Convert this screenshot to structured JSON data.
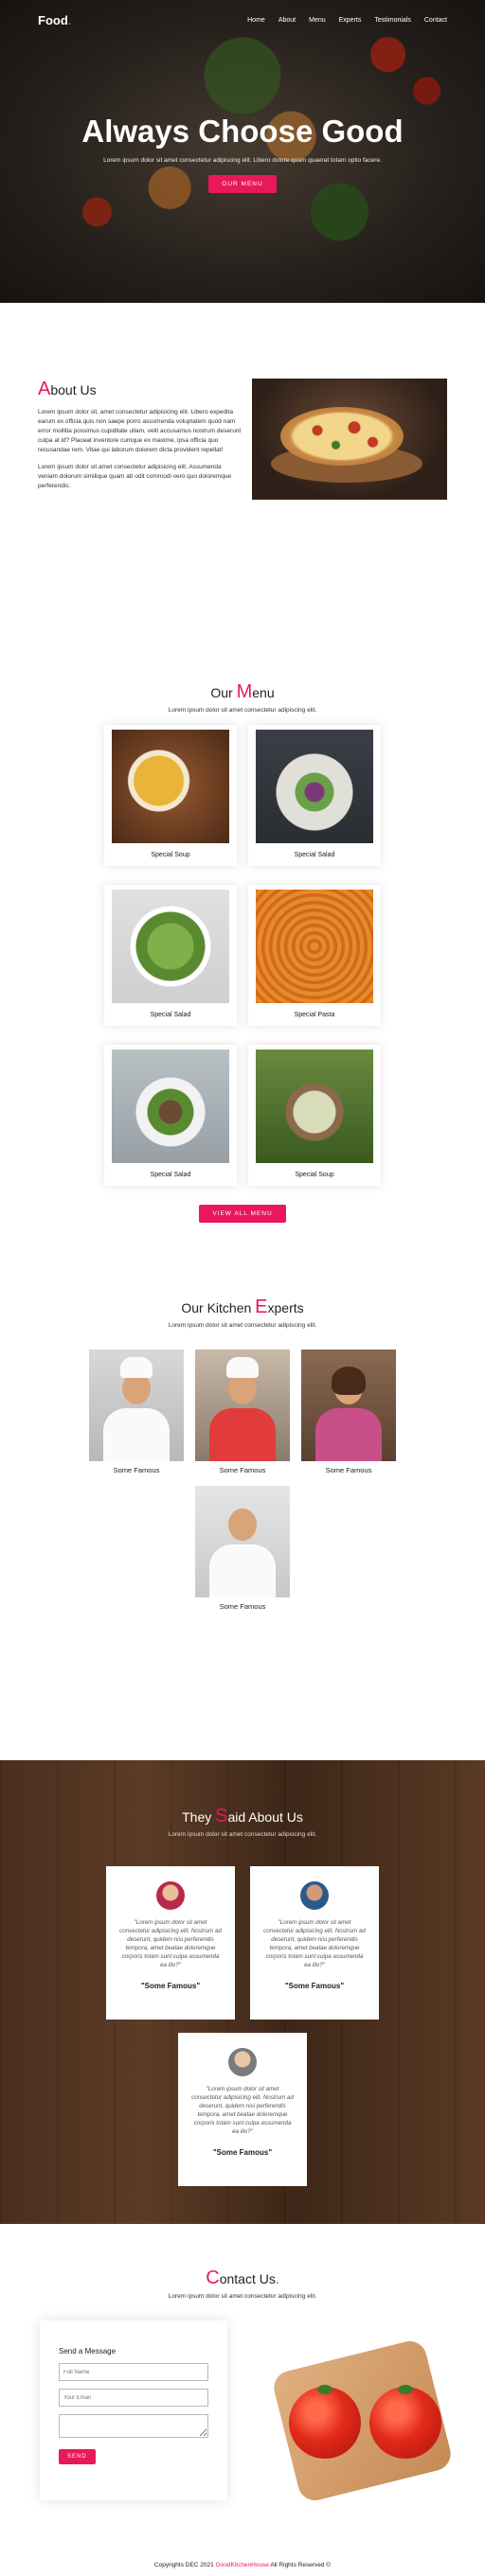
{
  "nav": {
    "logo": "Food",
    "logo_dot": ".",
    "links": [
      "Home",
      "About",
      "Menu",
      "Experts",
      "Testimonials",
      "Contact"
    ]
  },
  "hero": {
    "title": "Always Choose Good",
    "subtitle": "Lorem ipsum dolor sit amet consectetur adipiscing elit. Libero dolore quam quaerat totam optio facere.",
    "button": "OUR MENU"
  },
  "about": {
    "title_initial": "A",
    "title_rest": "bout Us",
    "p1": "Lorem ipsum dolor sit, amet consectetur adipisicing elit. Libero expedita earum ex officia quis non saepe porro assumenda voluptatem quod nam error mollitia possimus cupiditate ullam, velit accusamus nostrum deserunt culpa at id? Placeat inventore cumque ex maxime, ipsa officia quo recusandae rem. Vitae qui laborum dolorem dicta provident repellat!",
    "p2": "Lorem ipsum dolor sit amet consectetur adipisicing elit. Assumenda veniam dolorum similique quam ab odit commodi vero quo doloremque perferendis."
  },
  "menu": {
    "title_prefix": "Our ",
    "title_initial": "M",
    "title_rest": "enu",
    "subtitle": "Lorem ipsum dolor sit amet consectetur adipiscing elit.",
    "items": [
      "Special Soup",
      "Special Salad",
      "Special Salad",
      "Special Pasta",
      "Special Salad",
      "Special Soup"
    ],
    "button": "VIEW ALL MENU"
  },
  "experts": {
    "title_prefix": "Our Kitchen ",
    "title_initial": "E",
    "title_rest": "xperts",
    "subtitle": "Lorem ipsum dolor sit amet consectetur adipiscing elit.",
    "names": [
      "Some Famous",
      "Some Famous",
      "Some Famous",
      "Some Famous"
    ]
  },
  "testimonials": {
    "title_prefix": "They ",
    "title_initial": "S",
    "title_rest": "aid About Us",
    "subtitle": "Lorem ipsum dolor sit amet consectetur adipiscing elit.",
    "quote": "\"Lorem ipsum dolor sit amet consectetur adipisicing elit. Nostrum ad deserunt, quidem nisi perferendis tempora, amet beatae doloremque corporis totam sunt culpa assumenda ea illo?\"",
    "names": [
      "\"Some Famous\"",
      "\"Some Famous\"",
      "\"Some Famous\""
    ]
  },
  "contact": {
    "title_initial": "C",
    "title_rest": "ontact Us",
    "title_dot": ".",
    "subtitle": "Lorem ipsum dolor sit amet consectetur adipiscing elit.",
    "form_title": "Send a Message",
    "name_placeholder": "Full Name",
    "email_placeholder": "Your Email",
    "message_placeholder": "",
    "button": "SEND"
  },
  "footer": {
    "prefix": "Copyrights DEC 2021 ",
    "brand": "GoodKitchenHouse",
    "suffix": " All Rights Reserved ©"
  },
  "colors": {
    "accent": "#e8185a",
    "wood": "#4b2f1e"
  }
}
